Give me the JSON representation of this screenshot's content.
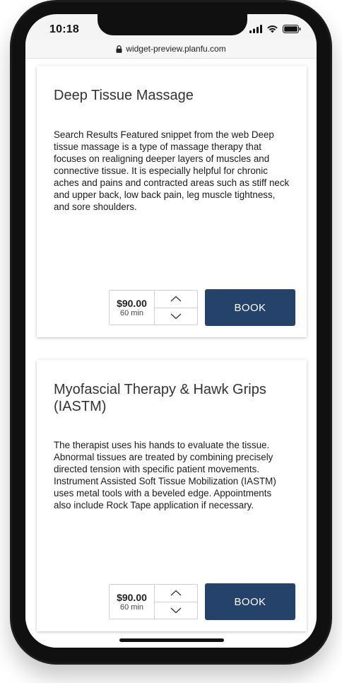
{
  "status_bar": {
    "time": "10:18",
    "icons": [
      "signal-icon",
      "wifi-icon",
      "battery-icon"
    ]
  },
  "browser": {
    "url": "widget-preview.planfu.com",
    "lock_icon": "lock-icon"
  },
  "services": [
    {
      "title": "Deep Tissue Massage",
      "description": "Search Results Featured snippet from the web Deep tissue massage is a type of massage therapy that focuses on realigning deeper layers of muscles and connective tissue. It is especially helpful for chronic aches and pains and contracted areas such as stiff neck and upper back, low back pain, leg muscle tightness, and sore shoulders.",
      "price": "$90.00",
      "duration": "60 min",
      "book_label": "BOOK"
    },
    {
      "title": "Myofascial Therapy & Hawk Grips (IASTM)",
      "description": "The therapist uses his hands to evaluate the tissue. Abnormal tissues are treated by combining precisely directed tension with specific patient movements. Instrument Assisted Soft Tissue Mobilization (IASTM) uses metal tools with a beveled edge. Appointments also include Rock Tape application if necessary.",
      "price": "$90.00",
      "duration": "60 min",
      "book_label": "BOOK"
    }
  ],
  "colors": {
    "book_button": "#25426a",
    "phone_frame": "#1c1c1e",
    "card_background": "#ffffff"
  }
}
